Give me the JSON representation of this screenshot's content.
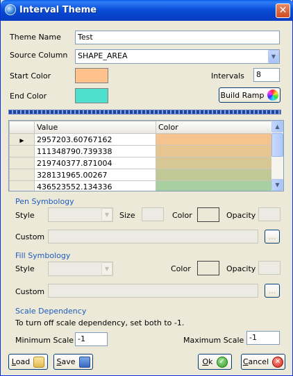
{
  "window": {
    "title": "Interval Theme",
    "close": "✕"
  },
  "form": {
    "theme_name_label": "Theme Name",
    "theme_name_value": "Test",
    "source_column_label": "Source Column",
    "source_column_value": "SHAPE_AREA",
    "start_color_label": "Start Color",
    "start_color": "#ffc28a",
    "end_color_label": "End Color",
    "end_color": "#4ee0cc",
    "intervals_label": "Intervals",
    "intervals_value": "8",
    "build_ramp_label": "Build Ramp"
  },
  "grid": {
    "columns": [
      "Value",
      "Color"
    ],
    "rows": [
      {
        "value": "2957203.60767162",
        "color": "#f5c48e",
        "current": true
      },
      {
        "value": "111348790.739338",
        "color": "#e6c591",
        "current": false
      },
      {
        "value": "219740377.871004",
        "color": "#d6c794",
        "current": false
      },
      {
        "value": "328131965.00267",
        "color": "#c0c996",
        "current": false
      },
      {
        "value": "436523552.134336",
        "color": "#a8cfa0",
        "current": false
      }
    ]
  },
  "pen": {
    "title": "Pen Symbology",
    "style_label": "Style",
    "size_label": "Size",
    "color_label": "Color",
    "opacity_label": "Opacity",
    "custom_label": "Custom",
    "browse_label": "..."
  },
  "fill": {
    "title": "Fill Symbology",
    "style_label": "Style",
    "color_label": "Color",
    "opacity_label": "Opacity",
    "custom_label": "Custom",
    "browse_label": "..."
  },
  "scale": {
    "title": "Scale Dependency",
    "hint": "To turn off scale dependency, set both to -1.",
    "min_label": "Minimum Scale",
    "min_value": "-1",
    "max_label": "Maximum Scale",
    "max_value": "-1"
  },
  "buttons": {
    "load_key": "L",
    "load_rest": "oad",
    "save_key": "S",
    "save_rest": "ave",
    "ok_key": "O",
    "ok_rest": "k",
    "cancel_key": "C",
    "cancel_rest": "ancel"
  }
}
